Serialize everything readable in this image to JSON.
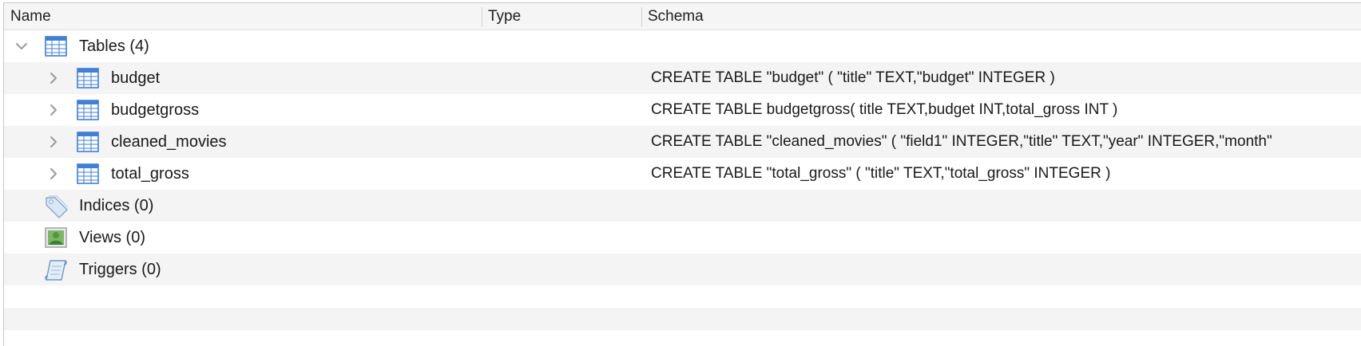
{
  "columns": {
    "name": "Name",
    "type": "Type",
    "schema": "Schema"
  },
  "tree": {
    "tables_group": {
      "label": "Tables (4)",
      "icon": "table-icon",
      "expanded": true,
      "children": [
        {
          "name": "budget",
          "type": "",
          "schema": "CREATE TABLE \"budget\" ( \"title\" TEXT,\"budget\" INTEGER )"
        },
        {
          "name": "budgetgross",
          "type": "",
          "schema": "CREATE TABLE budgetgross( title TEXT,budget INT,total_gross INT )"
        },
        {
          "name": "cleaned_movies",
          "type": "",
          "schema": "CREATE TABLE \"cleaned_movies\" ( \"field1\" INTEGER,\"title\" TEXT,\"year\" INTEGER,\"month\""
        },
        {
          "name": "total_gross",
          "type": "",
          "schema": "CREATE TABLE \"total_gross\" ( \"title\" TEXT,\"total_gross\" INTEGER )"
        }
      ]
    },
    "indices_group": {
      "label": "Indices (0)",
      "icon": "tag-icon"
    },
    "views_group": {
      "label": "Views (0)",
      "icon": "view-icon"
    },
    "triggers_group": {
      "label": "Triggers (0)",
      "icon": "scroll-icon"
    }
  },
  "colors": {
    "header_bg": "#f5f5f5",
    "alt_row_bg": "#f4f4f4",
    "table_icon_blue": "#3f7fd4",
    "view_icon_green": "#4f9a3c"
  }
}
